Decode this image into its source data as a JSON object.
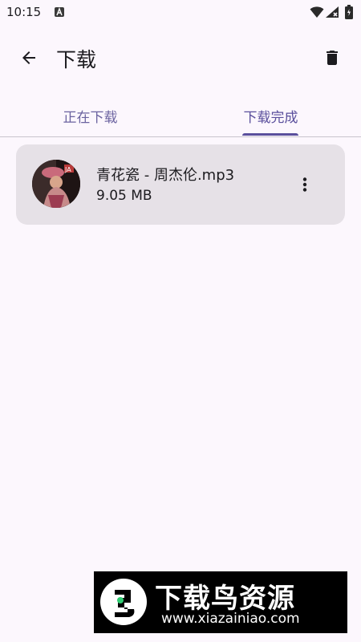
{
  "status_bar": {
    "time": "10:15"
  },
  "app_bar": {
    "title": "下载",
    "back_icon": "arrow-back-icon",
    "delete_icon": "trash-icon"
  },
  "tabs": [
    {
      "label": "正在下载",
      "selected": false
    },
    {
      "label": "下载完成",
      "selected": true
    }
  ],
  "downloads": [
    {
      "name": "青花瓷 - 周杰伦.mp3",
      "size": "9.05 MB",
      "menu_icon": "more-vert-icon"
    }
  ],
  "watermark": {
    "title": "下载鸟资源",
    "url": "www.xiazainiao.com"
  },
  "colors": {
    "background": "#fcf7fd",
    "accent": "#5a4f9c",
    "card": "#e6e1e7"
  }
}
